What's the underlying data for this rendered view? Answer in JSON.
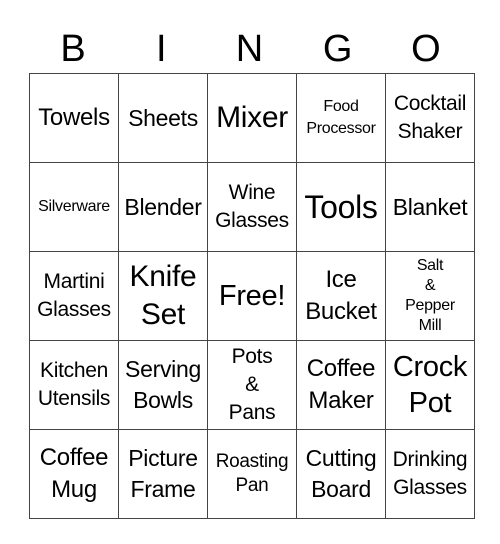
{
  "header": {
    "letters": [
      "B",
      "I",
      "N",
      "G",
      "O"
    ]
  },
  "rows": [
    [
      "Towels",
      "Sheets",
      "Mixer",
      "Food\nProcessor",
      "Cocktail\nShaker"
    ],
    [
      "Silverware",
      "Blender",
      "Wine\nGlasses",
      "Tools",
      "Blanket"
    ],
    [
      "Martini\nGlasses",
      "Knife\nSet",
      "Free!",
      "Ice\nBucket",
      "Salt\n&\nPepper\nMill"
    ],
    [
      "Kitchen\nUtensils",
      "Serving\nBowls",
      "Pots\n&\nPans",
      "Coffee\nMaker",
      "Crock\nPot"
    ],
    [
      "Coffee\nMug",
      "Picture\nFrame",
      "Roasting\nPan",
      "Cutting\nBoard",
      "Drinking\nGlasses"
    ]
  ]
}
